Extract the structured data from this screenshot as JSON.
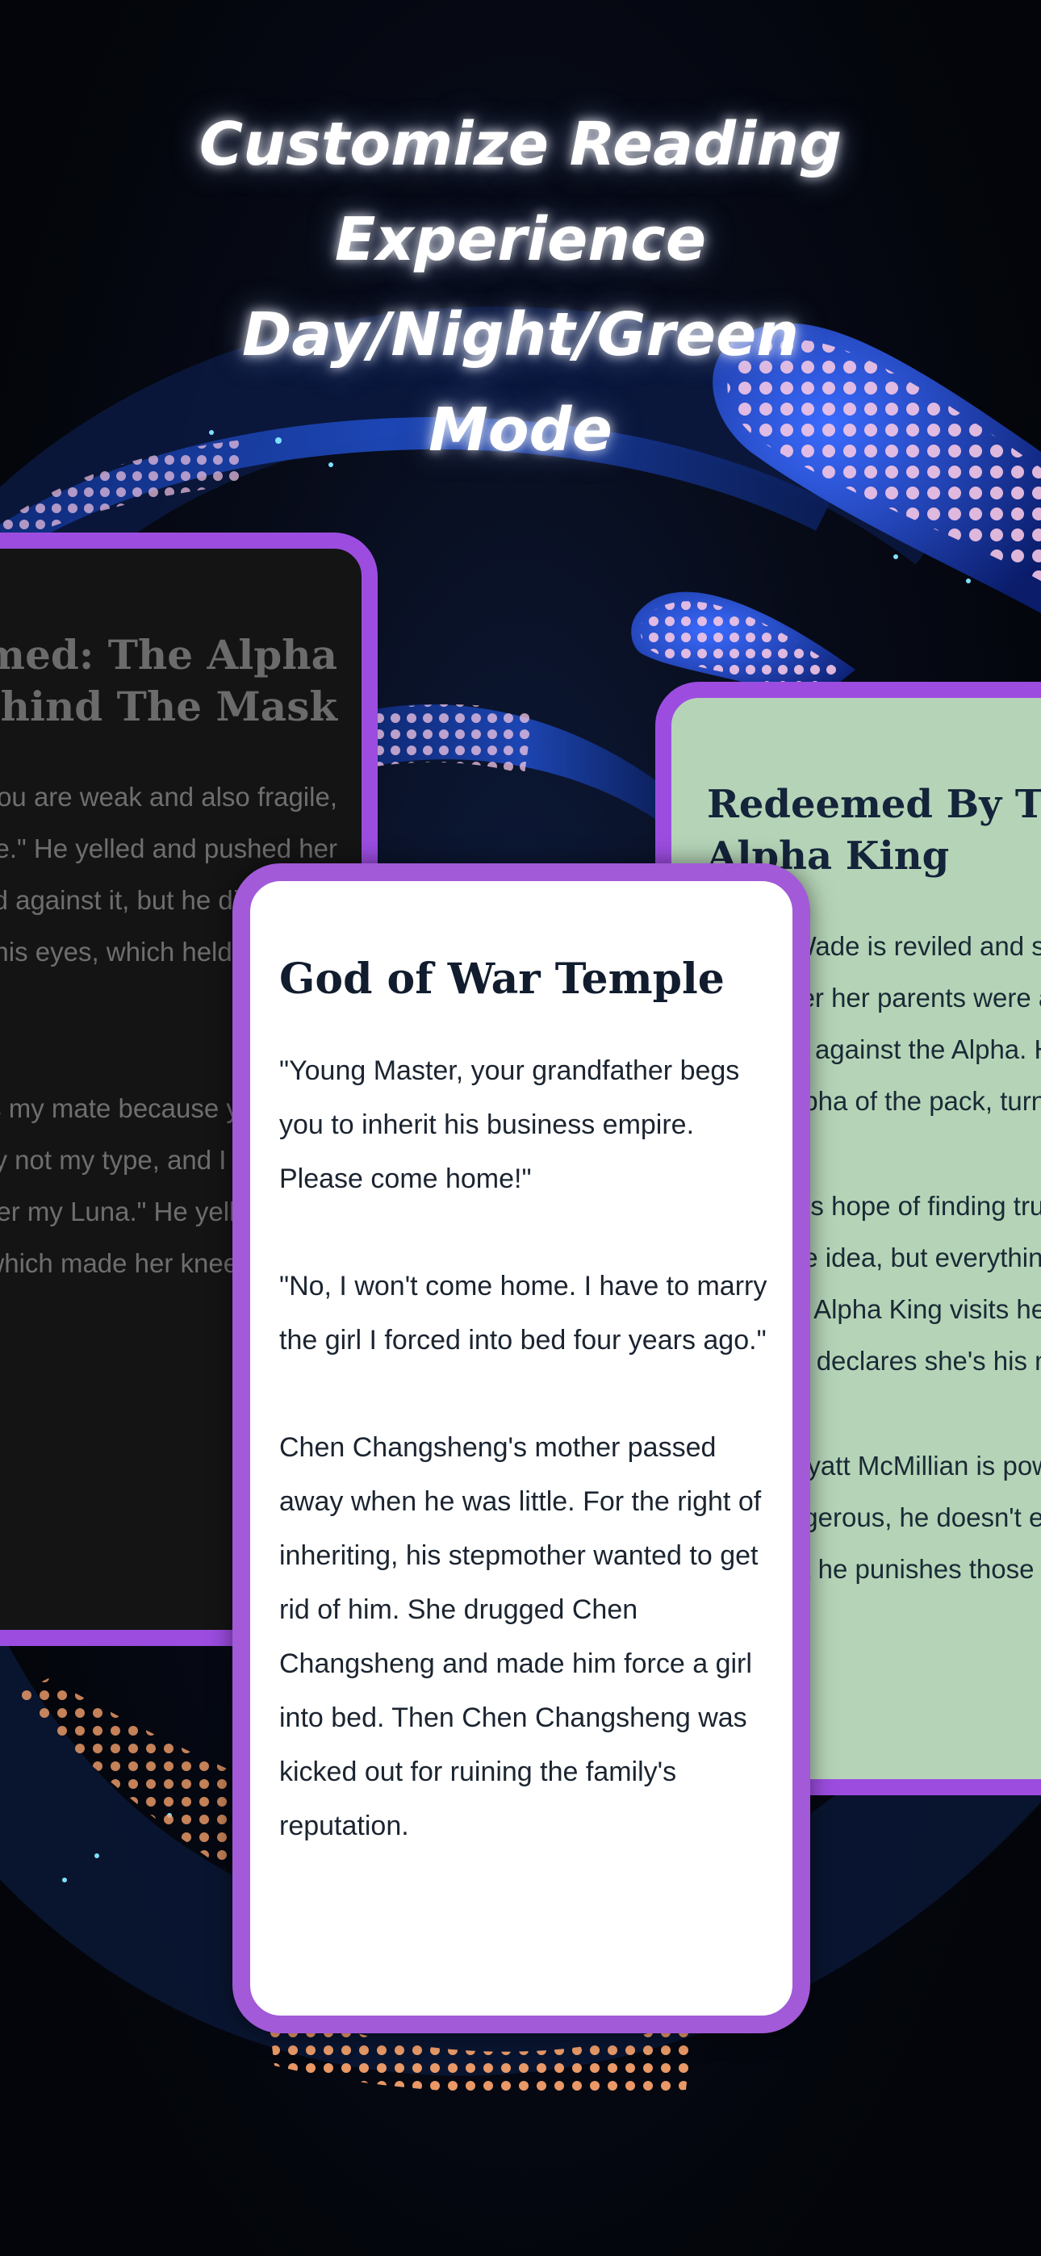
{
  "headline": {
    "line1": "Customize Reading",
    "line2": "Experience Day/Night/Green",
    "line3": "Mode"
  },
  "night_card": {
    "title_lines": [
      "Redeemed: The Alpha",
      "Behind The Mask"
    ],
    "body": [
      "\"You're not just a human, but you are weak and also fragile, so differ- ent from my type.\" He yelled and pushed her against the wall which she leaned against it, but he didn't look at him and glared straight into his eyes, which held fear and anger.",
      "\"I will never accept you as my mate because you are a human, and you are totally not my type, and I will mate someone else and will make her my Luna.\" He yelled those words loudly, which made her knees quiver."
    ]
  },
  "green_card": {
    "title_lines": [
      "Redeemed By The",
      "Alpha King"
    ],
    "body": [
      "Emma Wade is reviled and shunned by her pack after her parents were accused of planning against the Alpha. Her fiance, the future alpha of the pack, turns his back on her.",
      "She loses hope of finding true love and gives up on the idea, but everything turns when the powerful Alpha King visits her pack and to her surprise, declares she's his mate.",
      "Alpha Wyatt McMillian is powerful, handsome, and dangerous, he doesn't expect to find a Luna but he punishes those who harm what is his."
    ]
  },
  "white_card": {
    "title": "God of War Temple",
    "body": [
      "\"Young Master, your grandfather begs you to inherit his business empire. Please come home!\"",
      "\"No, I won't come home. I have to marry the girl I forced into bed four years ago.\"",
      "Chen Changsheng's mother passed away when he was little. For the right of inheriting, his stepmother wanted to get rid of him. She drugged Chen Changsheng and made him force a girl into bed. Then Chen Changsheng was kicked out for ruining the family's reputation."
    ]
  },
  "colors": {
    "background": "#05070d",
    "card_border": "#9c4de0",
    "night_bg": "#141414",
    "green_bg": "#b5d4b7",
    "white_bg": "#ffffff",
    "swirl": "#1b3fa8",
    "dots_pink": "#f4c6e4",
    "dots_orange": "#f5a06a"
  }
}
